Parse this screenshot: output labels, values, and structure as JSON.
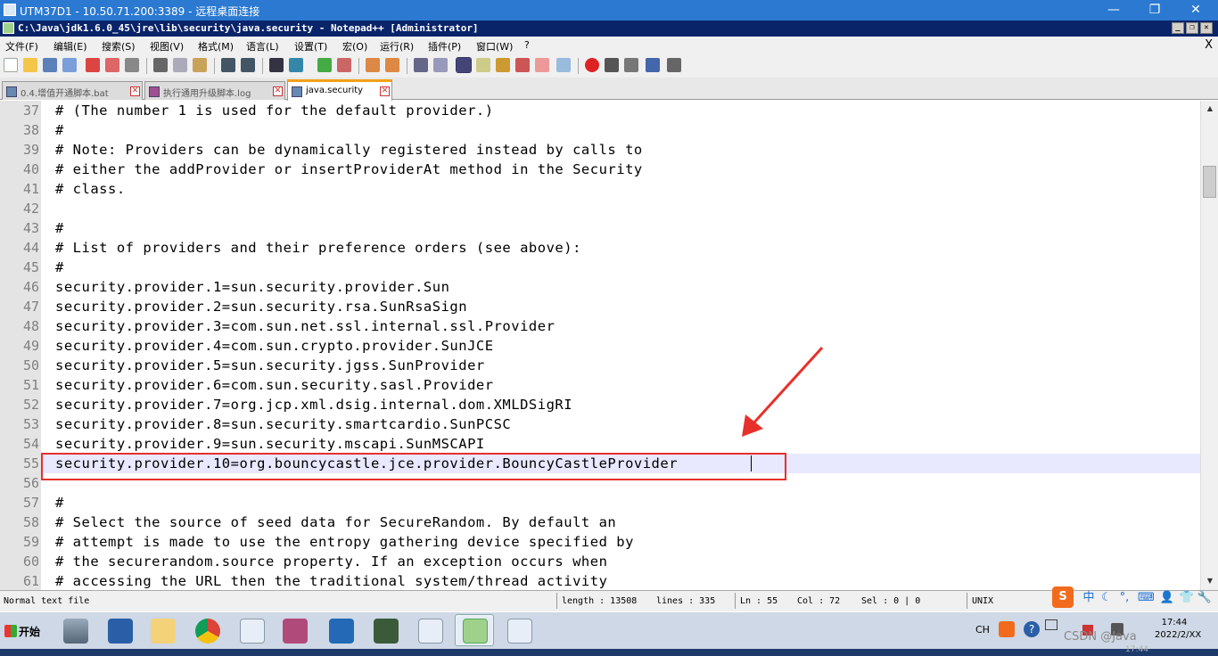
{
  "rdp": {
    "title": "UTM37D1 - 10.50.71.200:3389 - 远程桌面连接",
    "min": "—",
    "max": "❐",
    "close": "✕"
  },
  "notepad": {
    "title": "C:\\Java\\jdk1.6.0_45\\jre\\lib\\security\\java.security - Notepad++ [Administrator]",
    "menu": [
      "文件(F)",
      "编辑(E)",
      "搜索(S)",
      "视图(V)",
      "格式(M)",
      "语言(L)",
      "设置(T)",
      "宏(O)",
      "运行(R)",
      "插件(P)",
      "窗口(W)",
      "?"
    ],
    "menu_close": "X",
    "tabs": [
      {
        "label": "0.4.增值开通脚本.bat",
        "active": false
      },
      {
        "label": "执行通用升级脚本.log",
        "active": false
      },
      {
        "label": "java.security",
        "active": true
      }
    ]
  },
  "editor": {
    "lines": [
      {
        "n": "37",
        "t": "# (The number 1 is used for the default provider.)"
      },
      {
        "n": "38",
        "t": "#"
      },
      {
        "n": "39",
        "t": "# Note: Providers can be dynamically registered instead by calls to"
      },
      {
        "n": "40",
        "t": "# either the addProvider or insertProviderAt method in the Security"
      },
      {
        "n": "41",
        "t": "# class."
      },
      {
        "n": "42",
        "t": ""
      },
      {
        "n": "43",
        "t": "#"
      },
      {
        "n": "44",
        "t": "# List of providers and their preference orders (see above):"
      },
      {
        "n": "45",
        "t": "#"
      },
      {
        "n": "46",
        "t": "security.provider.1=sun.security.provider.Sun"
      },
      {
        "n": "47",
        "t": "security.provider.2=sun.security.rsa.SunRsaSign"
      },
      {
        "n": "48",
        "t": "security.provider.3=com.sun.net.ssl.internal.ssl.Provider"
      },
      {
        "n": "49",
        "t": "security.provider.4=com.sun.crypto.provider.SunJCE"
      },
      {
        "n": "50",
        "t": "security.provider.5=sun.security.jgss.SunProvider"
      },
      {
        "n": "51",
        "t": "security.provider.6=com.sun.security.sasl.Provider"
      },
      {
        "n": "52",
        "t": "security.provider.7=org.jcp.xml.dsig.internal.dom.XMLDSigRI"
      },
      {
        "n": "53",
        "t": "security.provider.8=sun.security.smartcardio.SunPCSC"
      },
      {
        "n": "54",
        "t": "security.provider.9=sun.security.mscapi.SunMSCAPI"
      },
      {
        "n": "55",
        "t": "security.provider.10=org.bouncycastle.jce.provider.BouncyCastleProvider"
      },
      {
        "n": "56",
        "t": ""
      },
      {
        "n": "57",
        "t": "#"
      },
      {
        "n": "58",
        "t": "# Select the source of seed data for SecureRandom. By default an"
      },
      {
        "n": "59",
        "t": "# attempt is made to use the entropy gathering device specified by"
      },
      {
        "n": "60",
        "t": "# the securerandom.source property. If an exception occurs when"
      },
      {
        "n": "61",
        "t": "# accessing the URL then the traditional system/thread activity"
      }
    ],
    "current_line": "55",
    "highlight_color": "#e8302b"
  },
  "status": {
    "type": "Normal text file",
    "length": "length : 13508",
    "lines": "lines : 335",
    "ln": "Ln : 55",
    "col": "Col : 72",
    "sel": "Sel : 0 | 0",
    "eol": "UNIX"
  },
  "taskbar": {
    "start": "开始",
    "lang": "CH",
    "time": "17:44",
    "date": "2022/2/XX",
    "watermark": "CSDN @Java",
    "bottom_time": "17:44"
  },
  "ime": {
    "logo": "S",
    "mode": "中"
  }
}
